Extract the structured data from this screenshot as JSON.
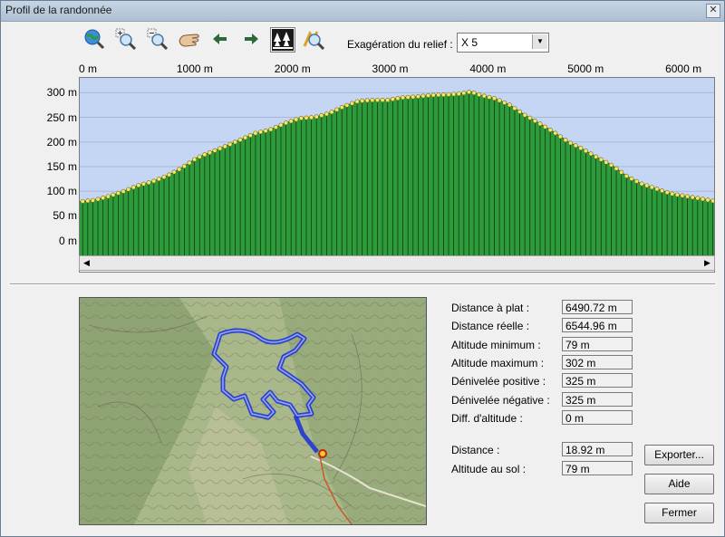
{
  "window": {
    "title": "Profil de la randonnée",
    "close_glyph": "✕"
  },
  "toolbar": {
    "buttons": [
      {
        "name": "globe-zoom-icon",
        "label": ""
      },
      {
        "name": "zoom-in-icon",
        "label": ""
      },
      {
        "name": "zoom-out-icon",
        "label": ""
      },
      {
        "name": "hand-pan-icon",
        "label": ""
      },
      {
        "name": "arrow-left-icon",
        "label": ""
      },
      {
        "name": "arrow-right-icon",
        "label": ""
      },
      {
        "name": "forest-icon",
        "label": ""
      },
      {
        "name": "zoom-profile-icon",
        "label": ""
      }
    ],
    "relief_label": "Exagération du relief :",
    "relief_value": "X 5"
  },
  "chart_data": {
    "type": "area",
    "x_tick_labels": [
      "0 m",
      "1000 m",
      "2000 m",
      "3000 m",
      "4000 m",
      "5000 m",
      "6000 m"
    ],
    "y_tick_labels": [
      "300 m",
      "250 m",
      "200 m",
      "150 m",
      "100 m",
      "50 m",
      "0 m"
    ],
    "x_ticks": [
      0,
      1000,
      2000,
      3000,
      4000,
      5000,
      6000
    ],
    "y_ticks": [
      300,
      250,
      200,
      150,
      100,
      50,
      0
    ],
    "xlim": [
      0,
      6490.72
    ],
    "ylim": [
      -30,
      330
    ],
    "x": [
      0,
      150,
      300,
      450,
      600,
      750,
      900,
      1050,
      1200,
      1350,
      1500,
      1650,
      1800,
      1950,
      2100,
      2250,
      2400,
      2550,
      2700,
      2850,
      3000,
      3150,
      3300,
      3450,
      3600,
      3750,
      3900,
      4000,
      4100,
      4250,
      4400,
      4550,
      4700,
      4850,
      5000,
      5150,
      5300,
      5450,
      5600,
      5750,
      5900,
      6050,
      6200,
      6350,
      6490
    ],
    "y": [
      79,
      82,
      90,
      100,
      112,
      120,
      132,
      148,
      168,
      180,
      192,
      205,
      218,
      225,
      238,
      248,
      250,
      258,
      272,
      283,
      285,
      285,
      290,
      292,
      295,
      296,
      298,
      302,
      295,
      288,
      275,
      255,
      238,
      220,
      200,
      185,
      168,
      152,
      130,
      115,
      105,
      95,
      90,
      85,
      80
    ],
    "fill_color": "#2e9b3a",
    "plot_bg": "#c4d6f4",
    "marker_color": "#f2e86a",
    "grid": true
  },
  "stats": [
    {
      "label": "Distance à plat :",
      "value": "6490.72 m"
    },
    {
      "label": "Distance réelle :",
      "value": "6544.96 m"
    },
    {
      "label": "Altitude minimum :",
      "value": "79 m"
    },
    {
      "label": "Altitude maximum :",
      "value": "302 m"
    },
    {
      "label": "Dénivelée positive :",
      "value": "325 m"
    },
    {
      "label": "Dénivelée négative :",
      "value": "325 m"
    },
    {
      "label": "Diff. d'altitude :",
      "value": "0 m"
    }
  ],
  "cursor": [
    {
      "label": "Distance :",
      "value": "18.92 m"
    },
    {
      "label": "Altitude au sol :",
      "value": "79 m"
    }
  ],
  "buttons": {
    "export": "Exporter...",
    "help": "Aide",
    "close": "Fermer"
  },
  "scroll": {
    "left": "◀",
    "right": "▶"
  }
}
